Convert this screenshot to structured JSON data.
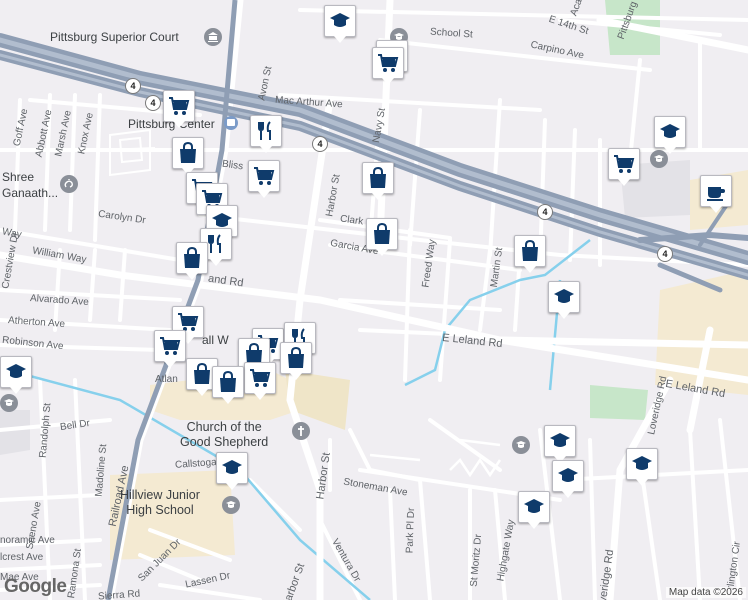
{
  "colors": {
    "pin": "#0f3b6b",
    "freeway": "#8f9eb4",
    "water": "#86d0ec",
    "park": "#c7e6c9",
    "school_area": "#f4ead2"
  },
  "streets": {
    "pittsburg_superior_court": "Pittsburg Superior Court",
    "school_st": "School St",
    "e14th": "E 14th St",
    "carpino": "Carpino Ave",
    "pittsburg": "Pittsburg",
    "acacia": "Aca",
    "avon": "Avon St",
    "macarthur": "Mac Arthur Ave",
    "navy": "Navy St",
    "goff": "Goff Ave",
    "abbott": "Abbott Ave",
    "marsh": "Marsh Ave",
    "knox": "Knox Ave",
    "pittsburg_center": "Pittsburg Center",
    "bliss": "Bliss",
    "shree": "Shree",
    "ganaath": "Ganaath...",
    "carolyn": "Carolyn Dr",
    "harbor_top": "Harbor St",
    "clark": "Clark",
    "garcia": "Garcia Ave",
    "freed": "Freed Way",
    "martin": "Martin St",
    "crestview": "Crestview Dr",
    "way": "Way",
    "william": "William Way",
    "leland_w": "and Rd",
    "alvarado": "Alvarado Ave",
    "atherton": "Atherton Ave",
    "robinson": "Robinson Ave",
    "mall": "all W",
    "e_leland": "E Leland Rd",
    "e_leland2": "E Leland Rd",
    "atlantic": "Atlan",
    "randolph": "Randolph St",
    "bell": "Bell Dr",
    "madoline": "Madoline St",
    "railroad": "Railroad Ave",
    "church": "Church of the\nGood Shepherd",
    "harbor_mid": "Harbor St",
    "callstoga": "Callstoga Dr",
    "hillview": "Hillview Junior\nHigh School",
    "stoneman": "Stoneman Ave",
    "park_pl": "Park Pl Dr",
    "st_moritz": "St Moritz Dr",
    "highgate": "Highgate Way",
    "loveridge": "Loveridge Rd",
    "loveridge2": "veridge Rd",
    "seeno": "Seeno Ave",
    "panoramic": "noramic Ave",
    "hillcrest": "lcrest Ave",
    "ramona": "Ramona St",
    "mae": "Mae Ave",
    "san_juan": "San Juan Dr",
    "lassen": "Lassen Dr",
    "sierra": "Sierra Rd",
    "ventura": "Ventura Dr",
    "harbor_bottom": "Harbor St",
    "burlington": "rlington Cir"
  },
  "shields": {
    "hw4": "4"
  },
  "attribution": "Map data ©2026",
  "logo": "Google",
  "pins": [
    {
      "icon": "school"
    },
    {
      "icon": "school"
    },
    {
      "icon": "shopping-cart"
    },
    {
      "icon": "school"
    },
    {
      "icon": "shopping-cart"
    },
    {
      "icon": "restaurant"
    },
    {
      "icon": "shopping-bag"
    },
    {
      "icon": "shopping-cart"
    },
    {
      "icon": "shopping-cart"
    },
    {
      "icon": "shopping-cart"
    },
    {
      "icon": "school"
    },
    {
      "icon": "shopping-bag"
    },
    {
      "icon": "shopping-bag"
    },
    {
      "icon": "shopping-bag"
    },
    {
      "icon": "restaurant"
    },
    {
      "icon": "shopping-bag"
    },
    {
      "icon": "school"
    },
    {
      "icon": "coffee"
    },
    {
      "icon": "shopping-cart"
    },
    {
      "icon": "shopping-cart"
    },
    {
      "icon": "shopping-cart"
    },
    {
      "icon": "restaurant"
    },
    {
      "icon": "shopping-bag"
    },
    {
      "icon": "school"
    },
    {
      "icon": "shopping-bag"
    },
    {
      "icon": "shopping-cart"
    },
    {
      "icon": "shopping-bag"
    },
    {
      "icon": "shopping-cart"
    },
    {
      "icon": "school"
    },
    {
      "icon": "school"
    },
    {
      "icon": "school"
    },
    {
      "icon": "school"
    },
    {
      "icon": "school"
    },
    {
      "icon": "school"
    }
  ]
}
